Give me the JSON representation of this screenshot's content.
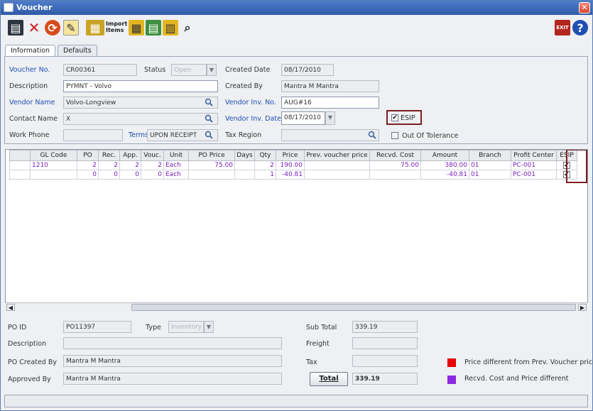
{
  "window": {
    "title": "Voucher",
    "close_glyph": "✕"
  },
  "toolbar": {
    "import_items_line1": "Import",
    "import_items_line2": "Items",
    "exit_label": "EXIT",
    "help_glyph": "?"
  },
  "tabs": [
    {
      "label": "Information",
      "active": true
    },
    {
      "label": "Defaults",
      "active": false
    }
  ],
  "header": {
    "voucher_no_label": "Voucher No.",
    "voucher_no": "CR00361",
    "status_label": "Status",
    "status": "Open",
    "created_date_label": "Created Date",
    "created_date": "08/17/2010",
    "description_label": "Description",
    "description": "PYMNT - Volvo",
    "created_by_label": "Created By",
    "created_by": "Mantra M Mantra",
    "vendor_name_label": "Vendor Name",
    "vendor_name": "Volvo-Longview",
    "vendor_inv_no_label": "Vendor Inv. No.",
    "vendor_inv_no": "AUG#16",
    "contact_name_label": "Contact Name",
    "contact_name": "X",
    "vendor_inv_date_label": "Vendor Inv. Date",
    "vendor_inv_date": "08/17/2010",
    "esip_label": "ESIP",
    "work_phone_label": "Work Phone",
    "work_phone": "",
    "terms_label": "Terms",
    "terms": "UPON RECEIPT",
    "tax_region_label": "Tax Region",
    "tax_region": "",
    "out_of_tolerance_label": "Out Of Tolerance"
  },
  "grid": {
    "columns": [
      "GL Code",
      "PO",
      "Rec.",
      "App.",
      "Vouc.",
      "Unit",
      "PO Price",
      "Days",
      "Qty",
      "Price",
      "Prev. voucher price",
      "Recvd. Cost",
      "Amount",
      "Branch",
      "Profit Center",
      "ESIP"
    ],
    "rows": [
      [
        "1210",
        "2",
        "2",
        "2",
        "2",
        "Each",
        "75.00",
        "",
        "2",
        "190.00",
        "",
        "75.00",
        "380.00",
        "01",
        "PC-001",
        "✔"
      ],
      [
        "",
        "0",
        "0",
        "0",
        "0",
        "Each",
        "",
        "",
        "1",
        "-40.81",
        "",
        "",
        "-40.81",
        "01",
        "PC-001",
        "✔"
      ]
    ]
  },
  "footer": {
    "po_id_label": "PO ID",
    "po_id": "PO11397",
    "type_label": "Type",
    "type": "Inventory",
    "description_label": "Description",
    "description": "",
    "po_created_by_label": "PO Created By",
    "po_created_by": "Mantra M Mantra",
    "approved_by_label": "Approved By",
    "approved_by": "Mantra M Mantra",
    "sub_total_label": "Sub Total",
    "sub_total": "339.19",
    "freight_label": "Freight",
    "freight": "",
    "tax_label": "Tax",
    "tax": "",
    "total_button": "Total",
    "total": "339.19",
    "legend_price_diff": "Price different from Prev. Voucher price",
    "legend_cost_diff": "Recvd. Cost and Price different"
  },
  "colors": {
    "title_bar": "#3a67b8",
    "required_label": "#1f4fb3",
    "legend_red": "#e50000",
    "legend_purple": "#8a2be2",
    "esip_highlight": "#7b1f1f"
  }
}
